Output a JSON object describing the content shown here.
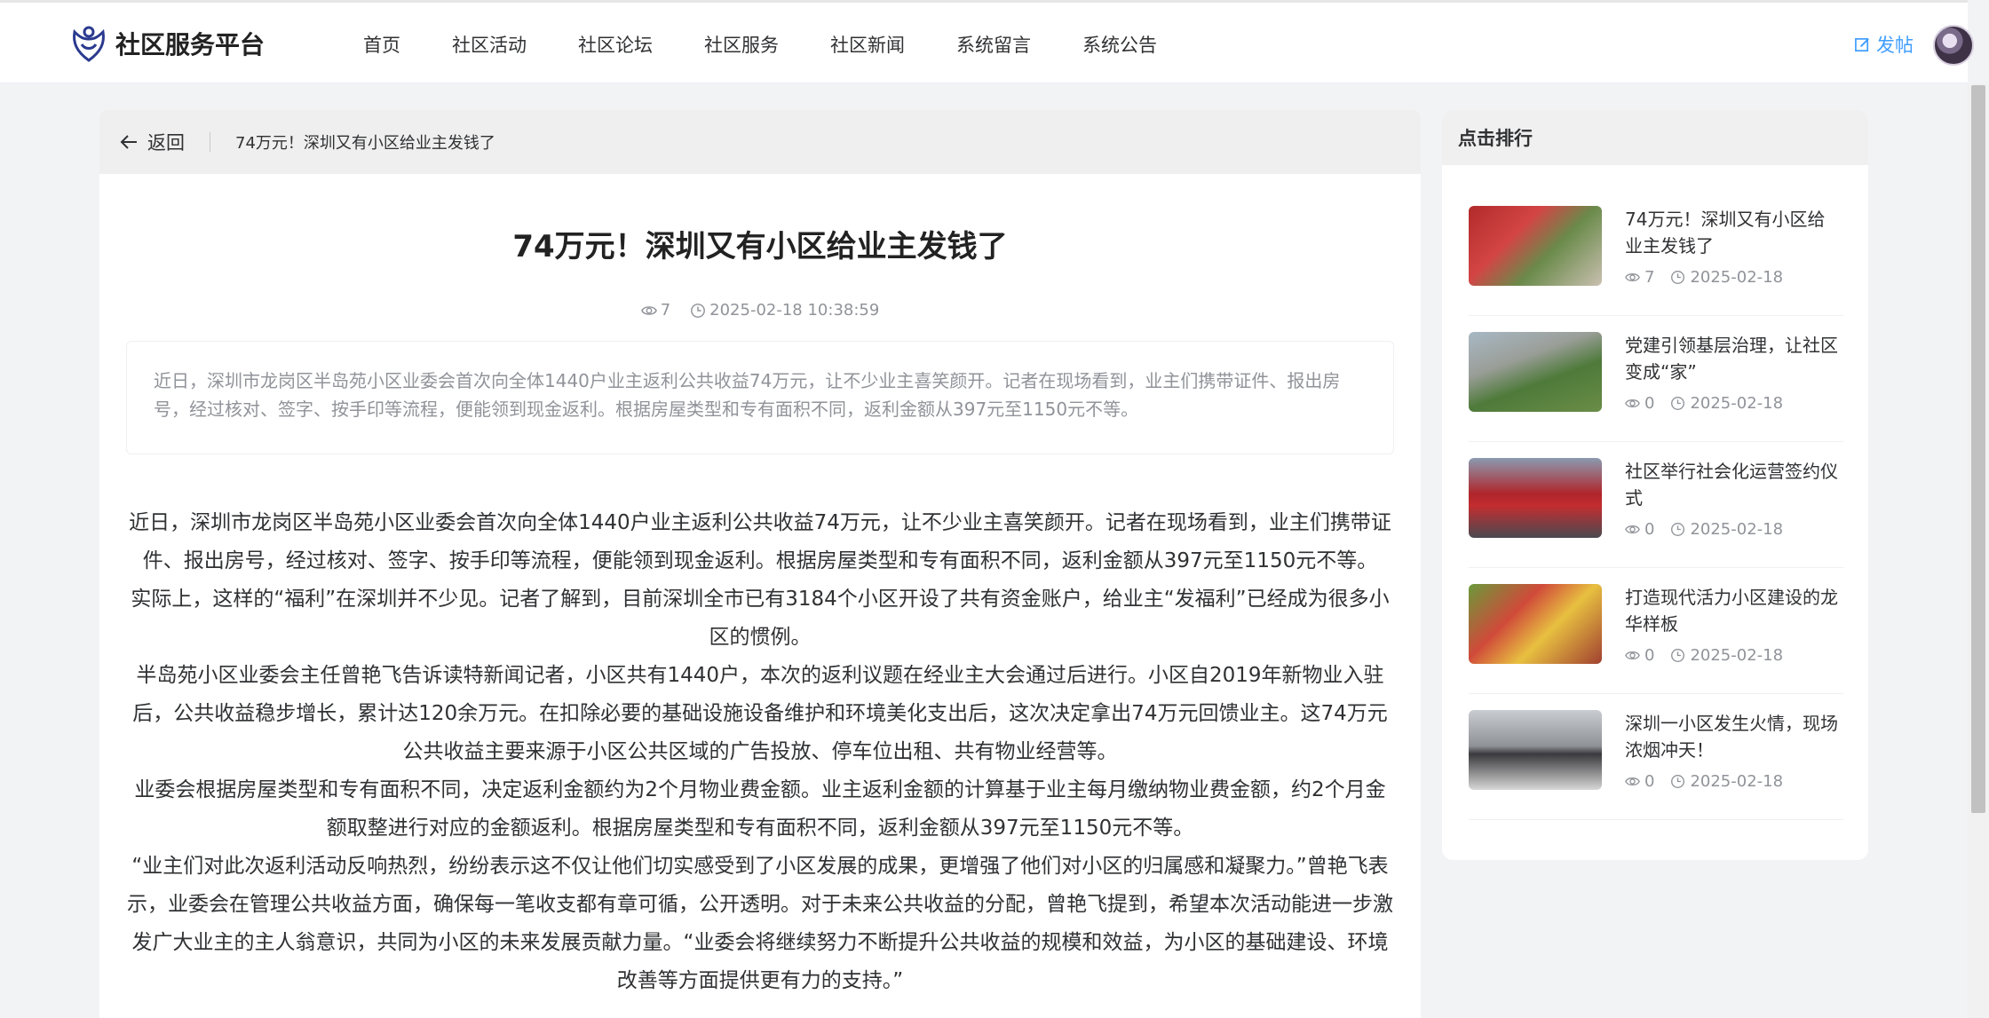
{
  "header": {
    "logo_text": "社区服务平台",
    "nav": [
      "首页",
      "社区活动",
      "社区论坛",
      "社区服务",
      "社区新闻",
      "系统留言",
      "系统公告"
    ],
    "post_label": "发帖"
  },
  "article": {
    "back_label": "返回",
    "breadcrumb_title": "74万元！深圳又有小区给业主发钱了",
    "title": "74万元！深圳又有小区给业主发钱了",
    "views": "7",
    "datetime": "2025-02-18 10:38:59",
    "summary": "近日，深圳市龙岗区半岛苑小区业委会首次向全体1440户业主返利公共收益74万元，让不少业主喜笑颜开。记者在现场看到，业主们携带证件、报出房号，经过核对、签字、按手印等流程，便能领到现金返利。根据房屋类型和专有面积不同，返利金额从397元至1150元不等。",
    "paragraphs": [
      "近日，深圳市龙岗区半岛苑小区业委会首次向全体1440户业主返利公共收益74万元，让不少业主喜笑颜开。记者在现场看到，业主们携带证件、报出房号，经过核对、签字、按手印等流程，便能领到现金返利。根据房屋类型和专有面积不同，返利金额从397元至1150元不等。",
      "实际上，这样的“福利”在深圳并不少见。记者了解到，目前深圳全市已有3184个小区开设了共有资金账户，给业主“发福利”已经成为很多小区的惯例。",
      "半岛苑小区业委会主任曾艳飞告诉读特新闻记者，小区共有1440户，本次的返利议题在经业主大会通过后进行。小区自2019年新物业入驻后，公共收益稳步增长，累计达120余万元。在扣除必要的基础设施设备维护和环境美化支出后，这次决定拿出74万元回馈业主。这74万元公共收益主要来源于小区公共区域的广告投放、停车位出租、共有物业经营等。",
      "业委会根据房屋类型和专有面积不同，决定返利金额约为2个月物业费金额。业主返利金额的计算基于业主每月缴纳物业费金额，约2个月金额取整进行对应的金额返利。根据房屋类型和专有面积不同，返利金额从397元至1150元不等。",
      "“业主们对此次返利活动反响热烈，纷纷表示这不仅让他们切实感受到了小区发展的成果，更增强了他们对小区的归属感和凝聚力。”曾艳飞表示，业委会在管理公共收益方面，确保每一笔收支都有章可循，公开透明。对于未来公共收益的分配，曾艳飞提到，希望本次活动能进一步激发广大业主的主人翁意识，共同为小区的未来发展贡献力量。“业委会将继续努力不断提升公共收益的规模和效益，为小区的基础建设、环境改善等方面提供更有力的支持。”"
    ]
  },
  "ranking": {
    "title": "点击排行",
    "items": [
      {
        "title": "74万元！深圳又有小区给业主发钱了",
        "views": "7",
        "date": "2025-02-18"
      },
      {
        "title": "党建引领基层治理，让社区变成“家”",
        "views": "0",
        "date": "2025-02-18"
      },
      {
        "title": "社区举行社会化运营签约仪式",
        "views": "0",
        "date": "2025-02-18"
      },
      {
        "title": "打造现代活力小区建设的龙华样板",
        "views": "0",
        "date": "2025-02-18"
      },
      {
        "title": "深圳一小区发生火情，现场浓烟冲天！",
        "views": "0",
        "date": "2025-02-18"
      }
    ]
  },
  "colors": {
    "accent": "#409eff",
    "text": "#303133",
    "muted": "#909399",
    "background": "#f2f3f5"
  }
}
